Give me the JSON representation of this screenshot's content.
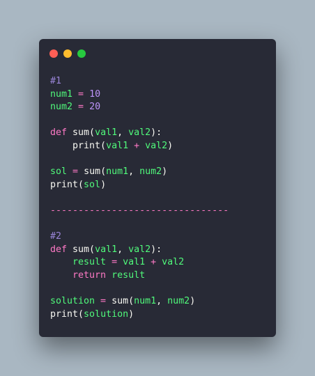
{
  "window": {
    "controls": {
      "close_color": "#ff5f56",
      "minimize_color": "#ffbd2e",
      "maximize_color": "#27c93f"
    }
  },
  "code": {
    "lines": [
      {
        "tokens": [
          {
            "t": "comment",
            "v": "#1"
          }
        ]
      },
      {
        "tokens": [
          {
            "t": "var",
            "v": "num1"
          },
          {
            "t": "op",
            "v": " = "
          },
          {
            "t": "num",
            "v": "10"
          }
        ]
      },
      {
        "tokens": [
          {
            "t": "var",
            "v": "num2"
          },
          {
            "t": "op",
            "v": " = "
          },
          {
            "t": "num",
            "v": "20"
          }
        ]
      },
      {
        "tokens": []
      },
      {
        "tokens": [
          {
            "t": "kw",
            "v": "def"
          },
          {
            "t": "fn",
            "v": " sum("
          },
          {
            "t": "param",
            "v": "val1"
          },
          {
            "t": "punct",
            "v": ", "
          },
          {
            "t": "param",
            "v": "val2"
          },
          {
            "t": "punct",
            "v": "):"
          }
        ]
      },
      {
        "tokens": [
          {
            "t": "fn",
            "v": "    print("
          },
          {
            "t": "param",
            "v": "val1"
          },
          {
            "t": "op",
            "v": " + "
          },
          {
            "t": "param",
            "v": "val2"
          },
          {
            "t": "punct",
            "v": ")"
          }
        ]
      },
      {
        "tokens": []
      },
      {
        "tokens": [
          {
            "t": "var",
            "v": "sol"
          },
          {
            "t": "op",
            "v": " = "
          },
          {
            "t": "fn",
            "v": "sum("
          },
          {
            "t": "param",
            "v": "num1"
          },
          {
            "t": "punct",
            "v": ", "
          },
          {
            "t": "param",
            "v": "num2"
          },
          {
            "t": "punct",
            "v": ")"
          }
        ]
      },
      {
        "tokens": [
          {
            "t": "fn",
            "v": "print("
          },
          {
            "t": "param",
            "v": "sol"
          },
          {
            "t": "punct",
            "v": ")"
          }
        ]
      },
      {
        "tokens": []
      },
      {
        "tokens": [
          {
            "t": "sep",
            "v": "--------------------------------"
          }
        ]
      },
      {
        "tokens": []
      },
      {
        "tokens": [
          {
            "t": "comment",
            "v": "#2"
          }
        ]
      },
      {
        "tokens": [
          {
            "t": "kw",
            "v": "def"
          },
          {
            "t": "fn",
            "v": " sum("
          },
          {
            "t": "param",
            "v": "val1"
          },
          {
            "t": "punct",
            "v": ", "
          },
          {
            "t": "param",
            "v": "val2"
          },
          {
            "t": "punct",
            "v": "):"
          }
        ]
      },
      {
        "tokens": [
          {
            "t": "var",
            "v": "    result"
          },
          {
            "t": "op",
            "v": " = "
          },
          {
            "t": "param",
            "v": "val1"
          },
          {
            "t": "op",
            "v": " + "
          },
          {
            "t": "param",
            "v": "val2"
          }
        ]
      },
      {
        "tokens": [
          {
            "t": "kw",
            "v": "    return"
          },
          {
            "t": "var",
            "v": " result"
          }
        ]
      },
      {
        "tokens": []
      },
      {
        "tokens": [
          {
            "t": "var",
            "v": "solution"
          },
          {
            "t": "op",
            "v": " = "
          },
          {
            "t": "fn",
            "v": "sum("
          },
          {
            "t": "param",
            "v": "num1"
          },
          {
            "t": "punct",
            "v": ", "
          },
          {
            "t": "param",
            "v": "num2"
          },
          {
            "t": "punct",
            "v": ")"
          }
        ]
      },
      {
        "tokens": [
          {
            "t": "fn",
            "v": "print("
          },
          {
            "t": "param",
            "v": "solution"
          },
          {
            "t": "punct",
            "v": ")"
          }
        ]
      }
    ]
  }
}
